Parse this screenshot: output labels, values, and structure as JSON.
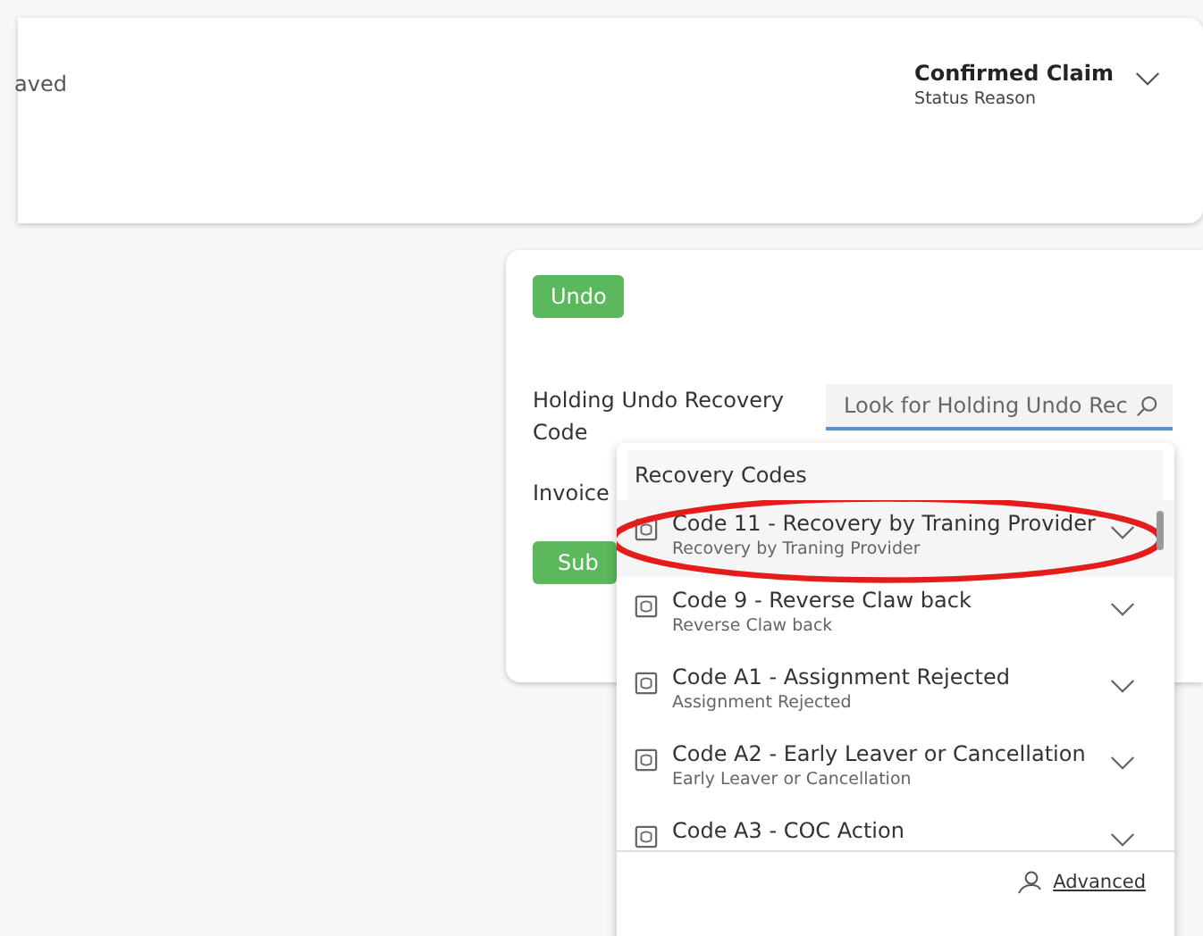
{
  "header": {
    "saved_text": "aved",
    "status": {
      "value": "Confirmed Claim",
      "label": "Status Reason"
    }
  },
  "form": {
    "undo_button": "Undo",
    "field_label": "Holding Undo Recovery Code",
    "field": {
      "placeholder": "Look for Holding Undo Rec"
    },
    "second_label": "Invoice",
    "submit_button": "Sub"
  },
  "dropdown": {
    "heading": "Recovery Codes",
    "items": [
      {
        "title": "Code 11 - Recovery by Traning Provider",
        "subtitle": "Recovery by Traning Provider",
        "selected": true
      },
      {
        "title": "Code 9 - Reverse Claw back",
        "subtitle": "Reverse Claw back",
        "selected": false
      },
      {
        "title": "Code A1 - Assignment Rejected",
        "subtitle": "Assignment Rejected",
        "selected": false
      },
      {
        "title": "Code A2 - Early Leaver or Cancellation",
        "subtitle": "Early Leaver or Cancellation",
        "selected": false
      },
      {
        "title": "Code A3 - COC Action",
        "selected": false
      }
    ],
    "advanced_link": "Advanced"
  }
}
